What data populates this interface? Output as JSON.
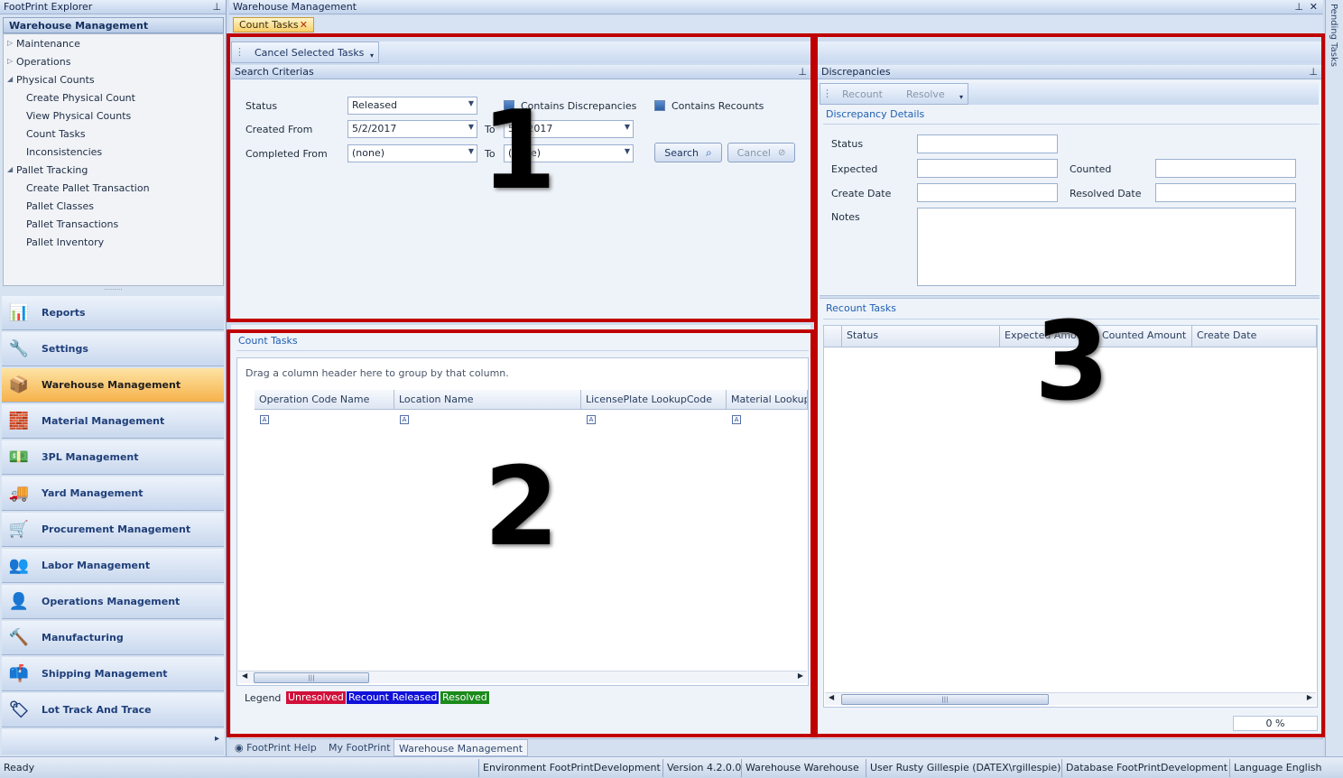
{
  "explorer": {
    "title": "FootPrint Explorer",
    "section": "Warehouse Management",
    "tree": [
      {
        "label": "Maintenance",
        "kind": "collapsed"
      },
      {
        "label": "Operations",
        "kind": "collapsed"
      },
      {
        "label": "Physical Counts",
        "kind": "expanded"
      },
      {
        "label": "Create Physical Count",
        "kind": "child"
      },
      {
        "label": "View Physical Counts",
        "kind": "child"
      },
      {
        "label": "Count Tasks",
        "kind": "child"
      },
      {
        "label": "Inconsistencies",
        "kind": "child"
      },
      {
        "label": "Pallet Tracking",
        "kind": "expanded"
      },
      {
        "label": "Create Pallet Transaction",
        "kind": "child"
      },
      {
        "label": "Pallet Classes",
        "kind": "child"
      },
      {
        "label": "Pallet Transactions",
        "kind": "child"
      },
      {
        "label": "Pallet Inventory",
        "kind": "child"
      }
    ],
    "nav": [
      {
        "label": "Reports",
        "icon": "reports-icon",
        "glyph": "📊"
      },
      {
        "label": "Settings",
        "icon": "settings-icon",
        "glyph": "🔧"
      },
      {
        "label": "Warehouse Management",
        "icon": "warehouse-icon",
        "glyph": "📦",
        "active": true
      },
      {
        "label": "Material Management",
        "icon": "material-icon",
        "glyph": "🧱"
      },
      {
        "label": "3PL Management",
        "icon": "3pl-icon",
        "glyph": "💵"
      },
      {
        "label": "Yard Management",
        "icon": "truck-icon",
        "glyph": "🚚"
      },
      {
        "label": "Procurement Management",
        "icon": "procurement-icon",
        "glyph": "🛒"
      },
      {
        "label": "Labor Management",
        "icon": "labor-icon",
        "glyph": "👥"
      },
      {
        "label": "Operations Management",
        "icon": "operations-icon",
        "glyph": "👤"
      },
      {
        "label": "Manufacturing",
        "icon": "manufacturing-icon",
        "glyph": "🔨"
      },
      {
        "label": "Shipping Management",
        "icon": "shipping-icon",
        "glyph": "📫"
      },
      {
        "label": "Lot Track And Trace",
        "icon": "lot-track-icon",
        "glyph": "🏷"
      }
    ]
  },
  "window": {
    "title": "Warehouse Management",
    "tab": "Count Tasks",
    "pending_tasks": "Pending Tasks"
  },
  "toolbar": {
    "cancel_selected": "Cancel Selected Tasks"
  },
  "search": {
    "title": "Search Criterias",
    "status_label": "Status",
    "status_value": "Released",
    "created_from_label": "Created From",
    "created_from_value": "5/2/2017",
    "to_label": "To",
    "created_to_value": "5/2/2017",
    "completed_from_label": "Completed From",
    "completed_from_value": "(none)",
    "completed_to_value": "(none)",
    "contains_discrepancies": "Contains Discrepancies",
    "contains_recounts": "Contains Recounts",
    "search_button": "Search",
    "cancel_button": "Cancel"
  },
  "count_tasks": {
    "title": "Count Tasks",
    "group_hint": "Drag a column header here to group by that column.",
    "columns": [
      "Operation Code Name",
      "Location Name",
      "LicensePlate LookupCode",
      "Material Lookup Code"
    ],
    "legend_label": "Legend",
    "legend": [
      {
        "label": "Unresolved",
        "color": "#d0103a"
      },
      {
        "label": "Recount Released",
        "color": "#1010d8"
      },
      {
        "label": "Resolved",
        "color": "#1a8a1a"
      }
    ]
  },
  "discrepancies": {
    "title": "Discrepancies",
    "recount_button": "Recount",
    "resolve_button": "Resolve",
    "details_title": "Discrepancy Details",
    "status_label": "Status",
    "expected_label": "Expected",
    "counted_label": "Counted",
    "create_date_label": "Create Date",
    "resolved_date_label": "Resolved Date",
    "notes_label": "Notes",
    "recount_title": "Recount Tasks",
    "recount_columns": [
      "Status",
      "Expected Amount",
      "Counted Amount",
      "Create Date"
    ],
    "progress": "0 %"
  },
  "annotations": [
    "1",
    "2",
    "3"
  ],
  "bottom_tabs": [
    "FootPrint Help",
    "My FootPrint",
    "Warehouse Management"
  ],
  "statusbar": {
    "ready": "Ready",
    "environment": "Environment  FootPrintDevelopment",
    "version": "Version  4.2.0.0",
    "warehouse": "Warehouse    Warehouse",
    "user": "User   Rusty Gillespie (DATEX\\rgillespie)",
    "database": "Database   FootPrintDevelopment",
    "language": "Language   English"
  }
}
